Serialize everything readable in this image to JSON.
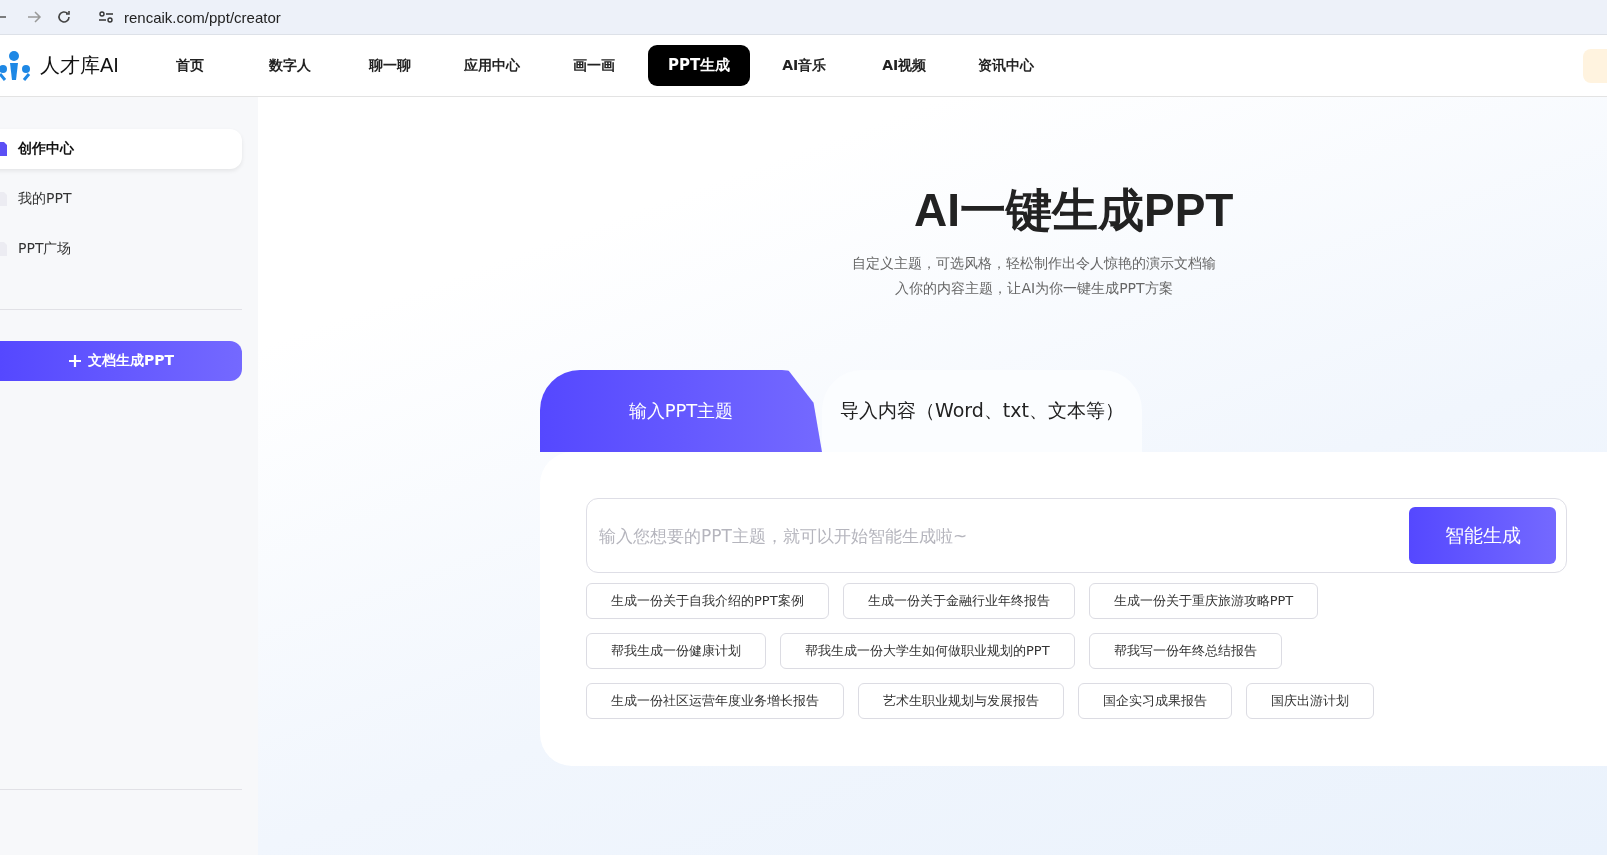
{
  "browser": {
    "url": "rencaik.com/ppt/creator"
  },
  "nav": {
    "logo_text": "人才库AI",
    "items": [
      {
        "label": "首页",
        "selected": false
      },
      {
        "label": "数字人",
        "selected": false
      },
      {
        "label": "聊一聊",
        "selected": false
      },
      {
        "label": "应用中心",
        "selected": false
      },
      {
        "label": "画一画",
        "selected": false
      },
      {
        "label": "PPT生成",
        "selected": true
      },
      {
        "label": "AI音乐",
        "selected": false
      },
      {
        "label": "AI视频",
        "selected": false
      },
      {
        "label": "资讯中心",
        "selected": false
      }
    ]
  },
  "sidebar": {
    "items": [
      {
        "label": "创作中心",
        "selected": true
      },
      {
        "label": "我的PPT",
        "selected": false
      },
      {
        "label": "PPT广场",
        "selected": false
      }
    ],
    "button": "文档生成PPT"
  },
  "hero": {
    "title": "AI一键生成PPT",
    "subtitle": [
      "自定义主题，可选风格，轻松制作出令人惊艳的演示文档输",
      "入你的内容主题，让AI为你一键生成PPT方案"
    ]
  },
  "tabs": [
    {
      "label": "输入PPT主题",
      "selected": true
    },
    {
      "label": "导入内容（Word、txt、文本等）",
      "selected": false
    }
  ],
  "input": {
    "placeholder": "输入您想要的PPT主题，就可以开始智能生成啦~",
    "button": "智能生成"
  },
  "suggestions": [
    [
      "生成一份关于自我介绍的PPT案例",
      "生成一份关于金融行业年终报告",
      "生成一份关于重庆旅游攻略PPT"
    ],
    [
      "帮我生成一份健康计划",
      "帮我生成一份大学生如何做职业规划的PPT",
      "帮我写一份年终总结报告"
    ],
    [
      "生成一份社区运营年度业务增长报告",
      "艺术生职业规划与发展报告",
      "国企实习成果报告",
      "国庆出游计划"
    ]
  ]
}
